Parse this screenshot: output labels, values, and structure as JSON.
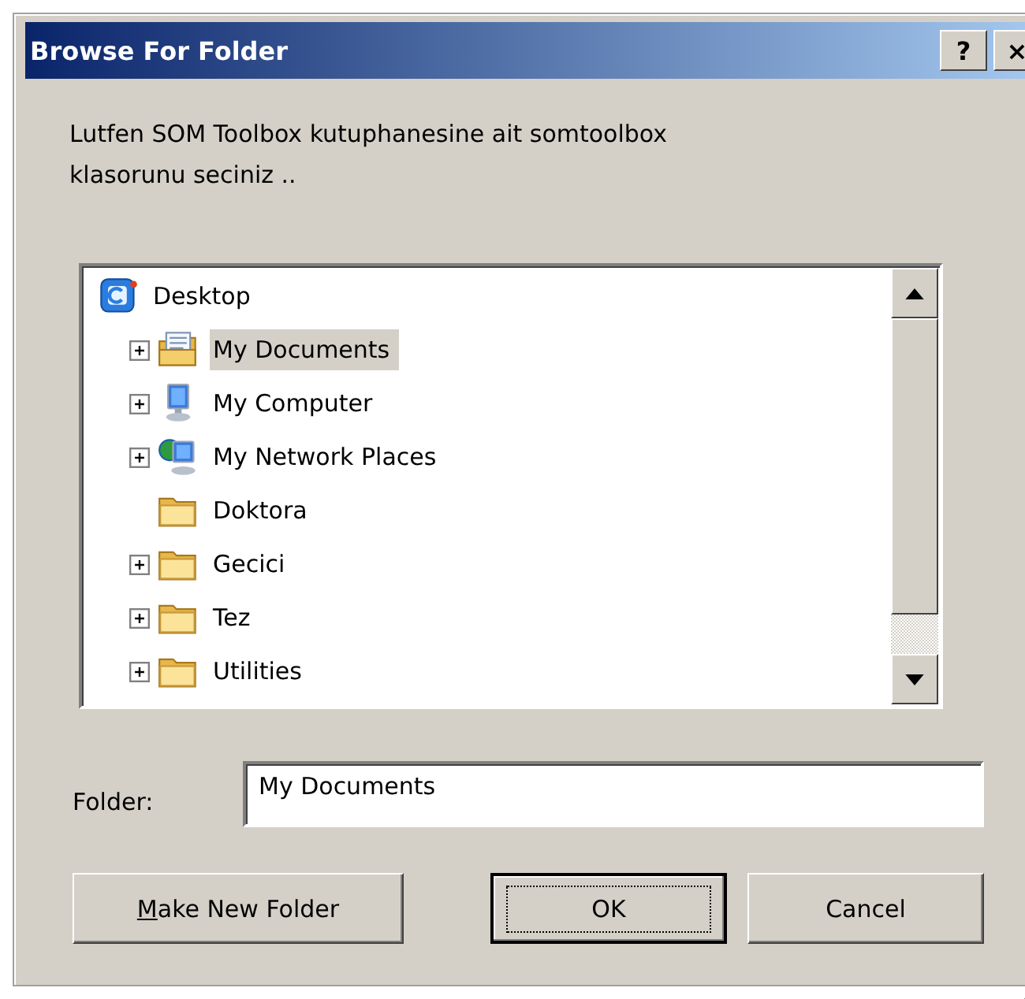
{
  "window": {
    "title": "Browse For Folder",
    "title_buttons": [
      "?",
      "×"
    ]
  },
  "message": "Lutfen SOM Toolbox kutuphanesine ait somtoolbox klasorunu seciniz ..",
  "tree": [
    {
      "label": "Desktop",
      "kind": "desktop",
      "expandable": false,
      "selected": false,
      "children": [
        {
          "label": "My Documents",
          "kind": "documents",
          "expandable": true,
          "selected": true
        },
        {
          "label": "My Computer",
          "kind": "computer",
          "expandable": true,
          "selected": false
        },
        {
          "label": "My Network Places",
          "kind": "network",
          "expandable": true,
          "selected": false
        },
        {
          "label": "Doktora",
          "kind": "folder",
          "expandable": false,
          "selected": false
        },
        {
          "label": "Gecici",
          "kind": "folder",
          "expandable": true,
          "selected": false
        },
        {
          "label": "Tez",
          "kind": "folder",
          "expandable": true,
          "selected": false
        },
        {
          "label": "Utilities",
          "kind": "folder",
          "expandable": true,
          "selected": false
        }
      ]
    }
  ],
  "folder_field": {
    "label": "Folder:",
    "value": "My Documents"
  },
  "buttons": [
    {
      "label": "Make New Folder",
      "mnemonic": true,
      "default": false
    },
    {
      "label": "OK",
      "default": true
    },
    {
      "label": "Cancel",
      "default": false
    }
  ]
}
